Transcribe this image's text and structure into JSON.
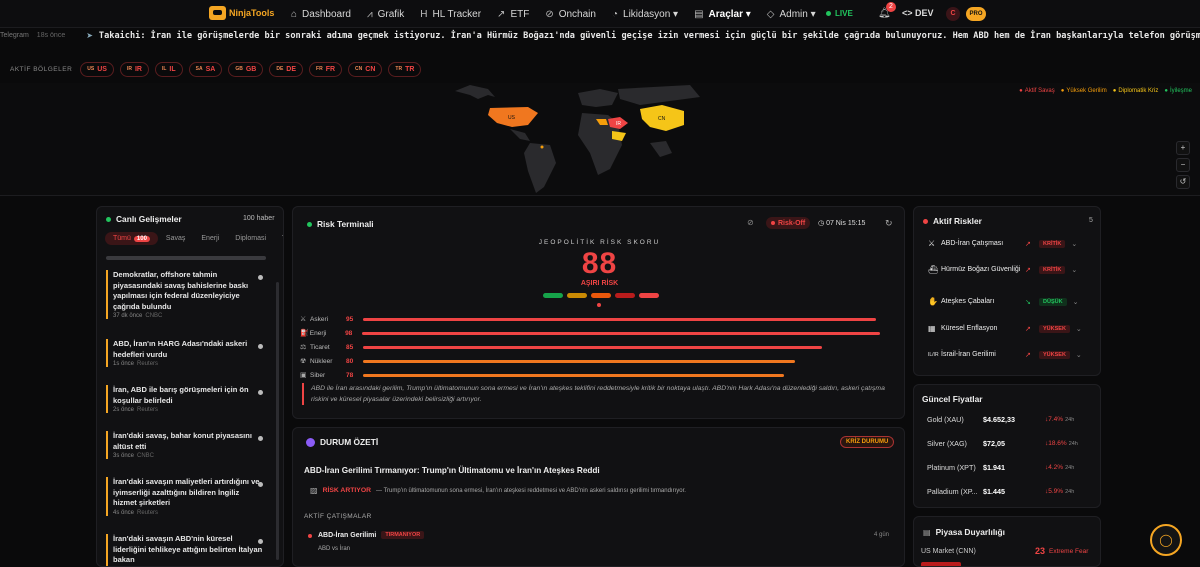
{
  "brand": {
    "name": "NinjaTools"
  },
  "nav": [
    {
      "icon": "⌂",
      "label": "Dashboard"
    },
    {
      "icon": "⩘",
      "label": "Grafik"
    },
    {
      "icon": "H",
      "label": "HL Tracker"
    },
    {
      "icon": "↗",
      "label": "ETF"
    },
    {
      "icon": "⊘",
      "label": "Onchain"
    },
    {
      "icon": "◔",
      "label": "Likidasyon ▾"
    },
    {
      "icon": "▤",
      "label": "Araçlar ▾"
    },
    {
      "icon": "◇",
      "label": "Admin ▾"
    }
  ],
  "header": {
    "live": "LIVE",
    "notif_count": "2",
    "dev": "DEV",
    "avatar": "C",
    "pro": "PRO"
  },
  "ticker": {
    "source": "Telegram",
    "time": "18s önce",
    "message": "Takaichi: İran ile görüşmelerde bir sonraki adıma geçmek istiyoruz. İran'a Hürmüz Boğazı'nda güvenli geçişe izin vermesi için güçlü bir şekilde çağrıda bulunuyoruz. Hem ABD hem de İran başkanlarıyla telefon görüşmesi yap"
  },
  "regions": {
    "label": "AKTİF BÖLGELER",
    "items": [
      {
        "code": "US",
        "name": "US"
      },
      {
        "code": "IR",
        "name": "IR"
      },
      {
        "code": "IL",
        "name": "IL"
      },
      {
        "code": "SA",
        "name": "SA"
      },
      {
        "code": "GB",
        "name": "GB"
      },
      {
        "code": "DE",
        "name": "DE"
      },
      {
        "code": "FR",
        "name": "FR"
      },
      {
        "code": "CN",
        "name": "CN"
      },
      {
        "code": "TR",
        "name": "TR"
      }
    ]
  },
  "map": {
    "legend": [
      "Aktif Savaş",
      "Yüksek Gerilim",
      "Diplomatik Kriz",
      "İyileşme"
    ],
    "labels": [
      "US",
      "IR",
      "CN"
    ],
    "controls": [
      "+",
      "−",
      "↺"
    ]
  },
  "news": {
    "title": "Canlı Gelişmeler",
    "count": "100 haber",
    "tabs": [
      "Tümü",
      "Savaş",
      "Enerji",
      "Diplomasi",
      "T"
    ],
    "tab_all_count": "100",
    "items": [
      {
        "title": "Demokratlar, offshore tahmin piyasasındaki savaş bahislerine baskı yapılması için federal düzenleyiciye çağrıda bulundu",
        "time": "37 dk önce",
        "source": "CNBC"
      },
      {
        "title": "ABD, İran'ın HARG Adası'ndaki askeri hedefleri vurdu",
        "time": "1s önce",
        "source": "Reuters"
      },
      {
        "title": "İran, ABD ile barış görüşmeleri için ön koşullar belirledi",
        "time": "2s önce",
        "source": "Reuters"
      },
      {
        "title": "İran'daki savaş, bahar konut piyasasını altüst etti",
        "time": "3s önce",
        "source": "CNBC"
      },
      {
        "title": "İran'daki savaşın maliyetleri artırdığını ve iyimserliği azalttığını bildiren İngiliz hizmet şirketleri",
        "time": "4s önce",
        "source": "Reuters"
      },
      {
        "title": "İran'daki savaşın ABD'nin küresel liderliğini tehlikeye attığını belirten İtalyan bakan",
        "time": "",
        "source": ""
      }
    ]
  },
  "risk": {
    "title": "Risk Terminali",
    "mode": "Risk-Off",
    "time": "07 Nis 15:15",
    "score_label": "JEOPOLİTİK RİSK SKORU",
    "score": "88",
    "score_text": "AŞIRI RİSK",
    "rows": [
      {
        "icon": "⚔",
        "name": "Askeri",
        "value": 95
      },
      {
        "icon": "⛽",
        "name": "Enerji",
        "value": 98
      },
      {
        "icon": "⚖",
        "name": "Ticaret",
        "value": 85
      },
      {
        "icon": "☢",
        "name": "Nükleer",
        "value": 80
      },
      {
        "icon": "▣",
        "name": "Siber",
        "value": 78
      }
    ],
    "description": "ABD ile İran arasındaki gerilim, Trump'ın ültimatomunun sona ermesi ve İran'ın ateşkes teklifini reddetmesiyle kritik bir noktaya ulaştı. ABD'nin Hark Adası'na düzenlediği saldırı, askeri çatışma riskini ve küresel piyasalar üzerindeki belirsizliği artırıyor."
  },
  "status": {
    "title": "DURUM ÖZETİ",
    "badge": "KRİZ DURUMU",
    "headline": "ABD-İran Gerilimi Tırmanıyor: Trump'ın Ültimatomu ve İran'ın Ateşkes Reddi",
    "trend_label": "RİSK ARTIYOR",
    "trend_desc": "— Trump'ın ültimatomunun sona ermesi, İran'ın ateşkesi reddetmesi ve ABD'nin askeri saldırısı gerilimi tırmandırıyor.",
    "active_label": "AKTİF ÇATIŞMALAR",
    "conflict": {
      "name": "ABD-İran Gerilimi",
      "state": "TIRMANIYOR",
      "days": "4 gün",
      "parties": "ABD vs İran"
    }
  },
  "active_risks": {
    "title": "Aktif Riskler",
    "count": "5",
    "items": [
      {
        "icon": "⚔",
        "name": "ABD-İran Çatışması",
        "badge": "KRİTİK",
        "tone": "r",
        "trend": "↗"
      },
      {
        "icon": "⛴",
        "name": "Hürmüz Boğazı Güvenliği",
        "badge": "KRİTİK",
        "tone": "r",
        "trend": "↗"
      },
      {
        "icon": "✋",
        "name": "Ateşkes Çabaları",
        "badge": "DÜŞÜK",
        "tone": "g",
        "trend": "↘"
      },
      {
        "icon": "▦",
        "name": "Küresel Enflasyon",
        "badge": "YÜKSEK",
        "tone": "r",
        "trend": "↗"
      },
      {
        "icon": "IL/IR",
        "name": "İsrail-İran Gerilimi",
        "badge": "YÜKSEK",
        "tone": "r",
        "trend": "↗"
      }
    ]
  },
  "prices": {
    "title": "Güncel Fiyatlar",
    "items": [
      {
        "name": "Gold (XAU)",
        "value": "$4.652,33",
        "change": "↓7.4%",
        "period": "24h"
      },
      {
        "name": "Silver (XAG)",
        "value": "$72,05",
        "change": "↓18.6%",
        "period": "24h"
      },
      {
        "name": "Platinum (XPT)",
        "value": "$1.941",
        "change": "↓4.2%",
        "period": "24h"
      },
      {
        "name": "Palladium (XP...",
        "value": "$1.445",
        "change": "↓5.9%",
        "period": "24h"
      }
    ]
  },
  "sentiment": {
    "title": "Piyasa Duyarlılığı",
    "label": "US Market (CNN)",
    "value": "23",
    "text": "Extreme Fear"
  },
  "colors": {
    "accent": "#f5a623",
    "danger": "#ef4444",
    "success": "#22c55e"
  }
}
